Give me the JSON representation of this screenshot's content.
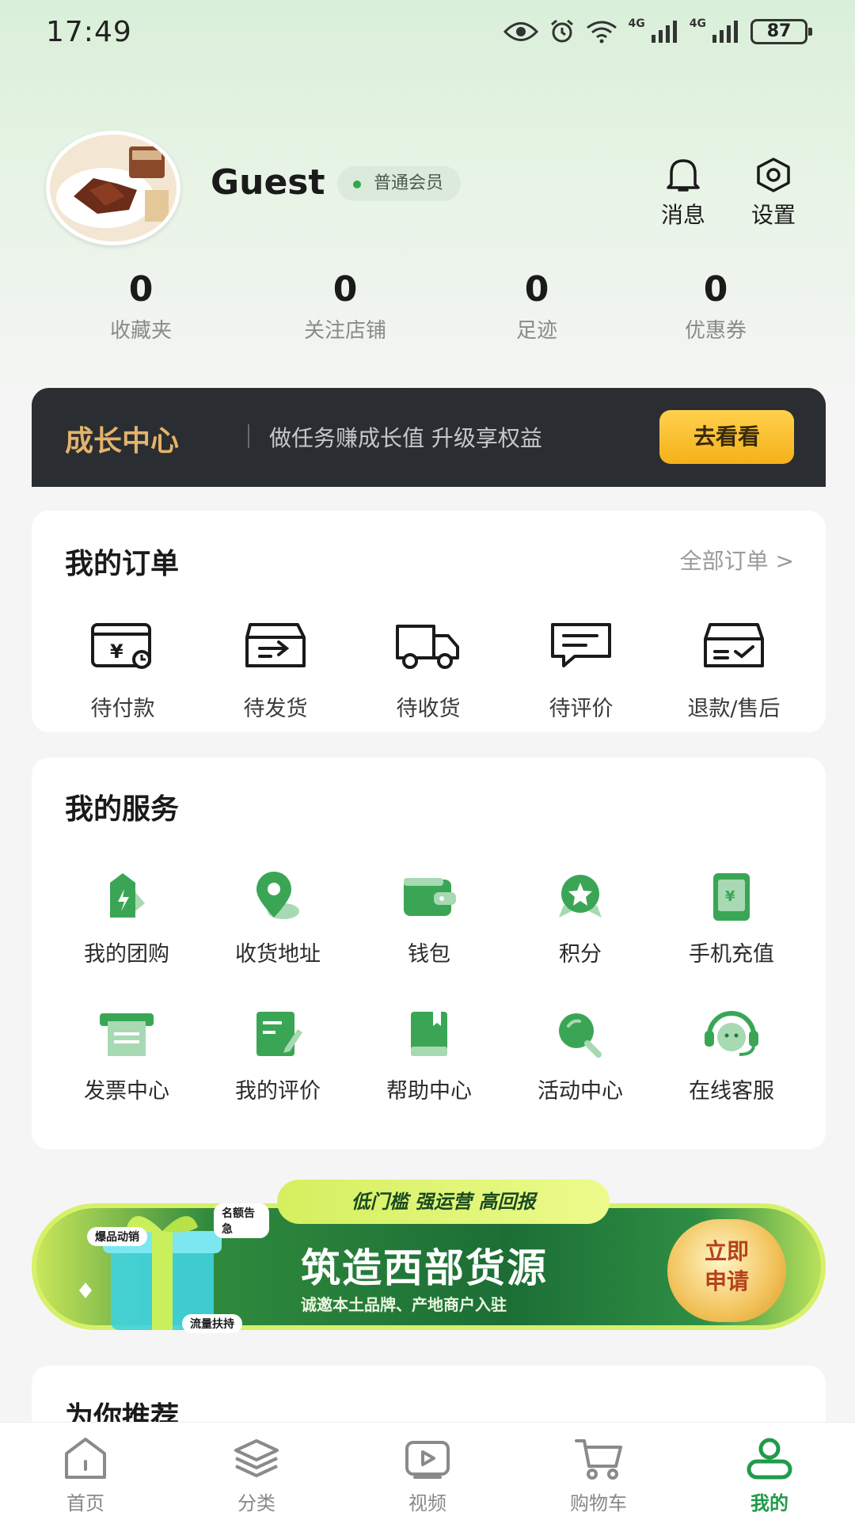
{
  "status": {
    "time": "17:49",
    "battery": "87",
    "network_1": "4G",
    "network_2": "4G"
  },
  "profile": {
    "username": "Guest",
    "member_level": "普通会员",
    "messages_label": "消息",
    "settings_label": "设置"
  },
  "stats": [
    {
      "value": "0",
      "label": "收藏夹"
    },
    {
      "value": "0",
      "label": "关注店铺"
    },
    {
      "value": "0",
      "label": "足迹"
    },
    {
      "value": "0",
      "label": "优惠券"
    }
  ],
  "growth": {
    "title": "成长中心",
    "description": "做任务赚成长值 升级享权益",
    "button": "去看看"
  },
  "orders": {
    "title": "我的订单",
    "all_link": "全部订单 >",
    "items": [
      {
        "label": "待付款",
        "icon": "pending-payment-icon"
      },
      {
        "label": "待发货",
        "icon": "pending-shipment-icon"
      },
      {
        "label": "待收货",
        "icon": "delivery-truck-icon"
      },
      {
        "label": "待评价",
        "icon": "review-message-icon"
      },
      {
        "label": "退款/售后",
        "icon": "refund-box-icon"
      }
    ]
  },
  "services": {
    "title": "我的服务",
    "items": [
      {
        "label": "我的团购",
        "icon": "group-buy-tag-icon"
      },
      {
        "label": "收货地址",
        "icon": "location-pin-icon"
      },
      {
        "label": "钱包",
        "icon": "wallet-icon"
      },
      {
        "label": "积分",
        "icon": "points-star-icon"
      },
      {
        "label": "手机充值",
        "icon": "phone-recharge-icon"
      },
      {
        "label": "发票中心",
        "icon": "invoice-icon"
      },
      {
        "label": "我的评价",
        "icon": "my-review-icon"
      },
      {
        "label": "帮助中心",
        "icon": "help-book-icon"
      },
      {
        "label": "活动中心",
        "icon": "activity-search-icon"
      },
      {
        "label": "在线客服",
        "icon": "headset-icon"
      }
    ],
    "accent_color": "#3aa655"
  },
  "promo": {
    "ribbon": "低门槛 强运营 高回报",
    "headline": "筑造西部货源",
    "subline": "诚邀本土品牌、产地商户入驻",
    "cta": "立即申请",
    "tag_1": "爆品动销",
    "tag_2": "名额告急",
    "tag_3": "流量扶持"
  },
  "recommend": {
    "title": "为你推荐"
  },
  "bottom_nav": [
    {
      "label": "首页",
      "icon": "home-icon"
    },
    {
      "label": "分类",
      "icon": "layers-icon"
    },
    {
      "label": "视频",
      "icon": "video-icon"
    },
    {
      "label": "购物车",
      "icon": "cart-icon"
    },
    {
      "label": "我的",
      "icon": "profile-icon",
      "active": true
    }
  ]
}
